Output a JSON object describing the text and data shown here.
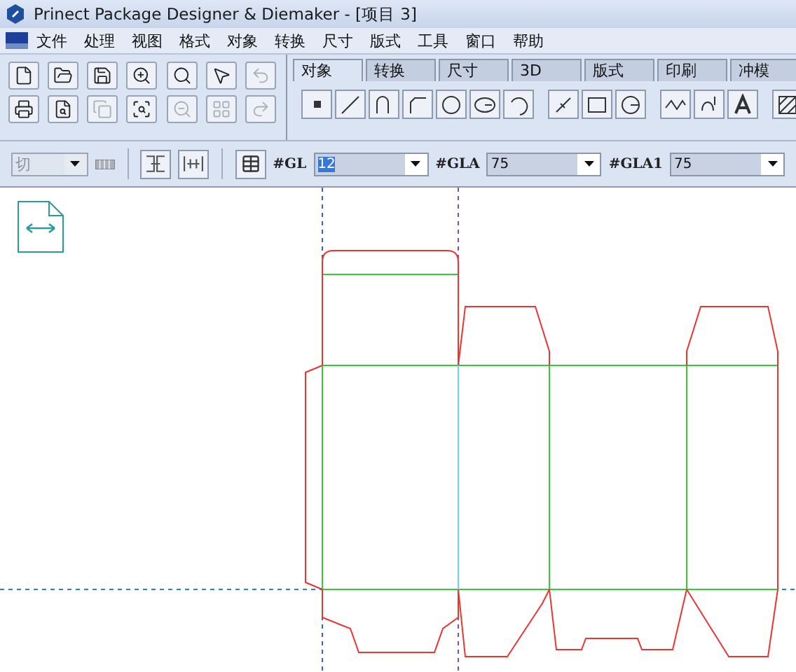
{
  "window": {
    "title": "Prinect Package Designer & Diemaker - [项目 3]"
  },
  "menu": [
    "文件",
    "处理",
    "视图",
    "格式",
    "对象",
    "转换",
    "尺寸",
    "版式",
    "工具",
    "窗口",
    "帮助"
  ],
  "main_toolbar": [
    {
      "kind": "new",
      "disabled": false
    },
    {
      "kind": "open",
      "disabled": false
    },
    {
      "kind": "save",
      "disabled": false
    },
    {
      "kind": "zoom-in",
      "disabled": false
    },
    {
      "kind": "zoom-fit",
      "disabled": false
    },
    {
      "kind": "pointer",
      "disabled": false
    },
    {
      "kind": "undo",
      "disabled": true
    },
    {
      "kind": "print",
      "disabled": false
    },
    {
      "kind": "preview",
      "disabled": false
    },
    {
      "kind": "copy",
      "disabled": true
    },
    {
      "kind": "zoom-window",
      "disabled": false
    },
    {
      "kind": "zoom-out",
      "disabled": true
    },
    {
      "kind": "grid",
      "disabled": true
    },
    {
      "kind": "redo",
      "disabled": true
    }
  ],
  "tabs": [
    {
      "label": "对象",
      "selected": true
    },
    {
      "label": "转换",
      "selected": false
    },
    {
      "label": "尺寸",
      "selected": false
    },
    {
      "label": "3D",
      "selected": false
    },
    {
      "label": "版式",
      "selected": false
    },
    {
      "label": "印刷",
      "selected": false
    },
    {
      "label": "冲模",
      "selected": false
    }
  ],
  "tool_buttons": [
    {
      "kind": "point"
    },
    {
      "kind": "line"
    },
    {
      "kind": "arc"
    },
    {
      "kind": "corner"
    },
    {
      "kind": "circle"
    },
    {
      "kind": "ellipse"
    },
    {
      "kind": "arc-3"
    },
    {
      "kind": "slash"
    },
    {
      "kind": "rect"
    },
    {
      "kind": "circle-line"
    },
    {
      "kind": "wave"
    },
    {
      "kind": "curve"
    },
    {
      "kind": "text"
    },
    {
      "kind": "hatch"
    }
  ],
  "layer_field": {
    "value": "切",
    "disabled": true
  },
  "fields": [
    {
      "label": "#GL",
      "value": "12",
      "selected": true
    },
    {
      "label": "#GLA",
      "value": "75",
      "selected": false
    },
    {
      "label": "#GLA1",
      "value": "75",
      "selected": false
    }
  ]
}
